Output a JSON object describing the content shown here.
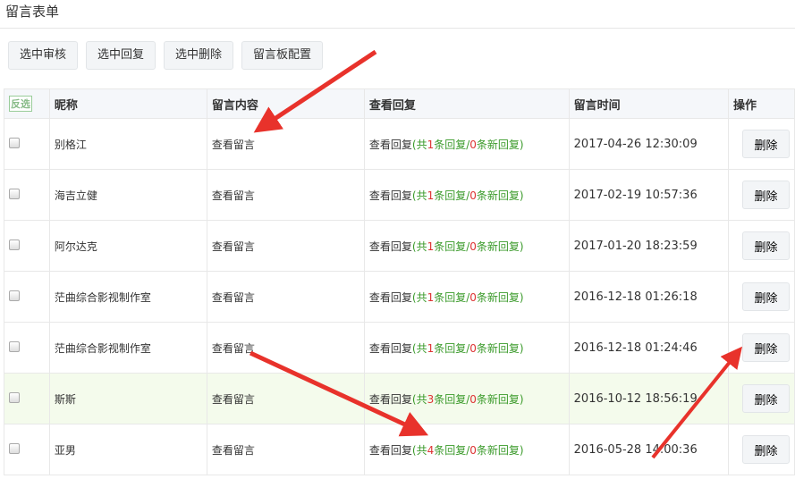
{
  "title": "留言表单",
  "toolbar": {
    "approve": "选中审核",
    "reply": "选中回复",
    "delete": "选中删除",
    "config": "留言板配置"
  },
  "headers": {
    "invert": "反选",
    "nickname": "昵称",
    "content": "留言内容",
    "reply": "查看回复",
    "time": "留言时间",
    "action": "操作"
  },
  "labels": {
    "view_msg": "查看留言",
    "view_reply": "查看回复",
    "total_prefix": "(共",
    "total_suffix": "条回复/",
    "new_suffix": "条新回复)",
    "delete": "删除"
  },
  "rows": [
    {
      "name": "别格江",
      "total": "1",
      "new": "0",
      "time": "2017-04-26 12:30:09"
    },
    {
      "name": "海吉立健",
      "total": "1",
      "new": "0",
      "time": "2017-02-19 10:57:36"
    },
    {
      "name": "阿尔达克",
      "total": "1",
      "new": "0",
      "time": "2017-01-20 18:23:59"
    },
    {
      "name": "茫曲综合影视制作室",
      "total": "1",
      "new": "0",
      "time": "2016-12-18 01:26:18"
    },
    {
      "name": "茫曲综合影视制作室",
      "total": "1",
      "new": "0",
      "time": "2016-12-18 01:24:46"
    },
    {
      "name": "斯斯",
      "total": "3",
      "new": "0",
      "time": "2016-10-12 18:56:19"
    },
    {
      "name": "亚男",
      "total": "4",
      "new": "0",
      "time": "2016-05-28 14:00:36"
    }
  ]
}
